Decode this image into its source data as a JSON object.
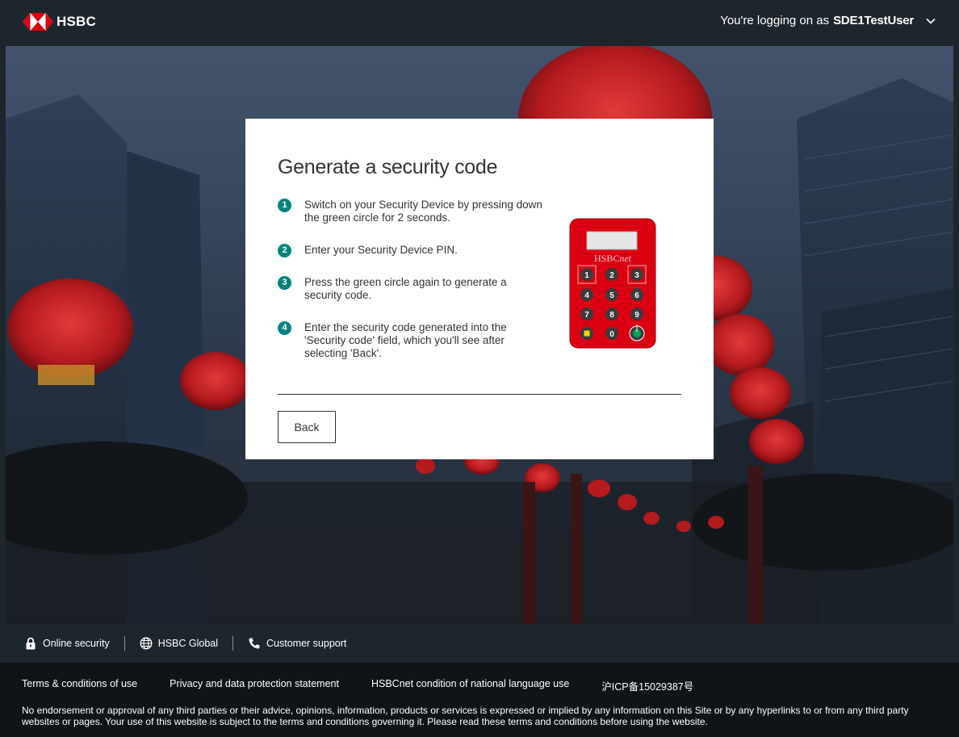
{
  "header": {
    "brand": "HSBC",
    "login_prefix": "You're logging on as",
    "username": "SDE1TestUser"
  },
  "dialog": {
    "title": "Generate a security code",
    "steps": [
      {
        "num": "1",
        "text": "Switch on your Security Device by pressing down the green circle for 2 seconds."
      },
      {
        "num": "2",
        "text": "Enter your Security Device PIN."
      },
      {
        "num": "3",
        "text": "Press the green circle again to generate a security code."
      },
      {
        "num": "4",
        "text": "Enter the security code generated into the 'Security code' field, which you'll see after selecting 'Back'."
      }
    ],
    "back_label": "Back",
    "device": {
      "brand_prefix": "HSBC",
      "brand_suffix": "net",
      "keys": [
        "1",
        "2",
        "3",
        "4",
        "5",
        "6",
        "7",
        "8",
        "9",
        "0"
      ],
      "body_color": "#db0011",
      "power_color": "#00a651"
    }
  },
  "quicklinks": {
    "online_security": "Online security",
    "global": "HSBC Global",
    "support": "Customer support"
  },
  "footer": {
    "terms": "Terms & conditions of use",
    "privacy": "Privacy and data protection statement",
    "language": "HSBCnet condition of national language use",
    "icp": "沪ICP备15029387号",
    "disclaimer": "No endorsement or approval of any third parties or their advice, opinions, information, products or services is expressed or implied by any information on this Site or by any hyperlinks to or from any third party websites or pages. Your use of this website is subject to the terms and conditions governing it. Please read these terms and conditions before using the website."
  },
  "colors": {
    "accent": "#00847f",
    "brand_red": "#db0011",
    "header_bg": "#1d262d"
  }
}
